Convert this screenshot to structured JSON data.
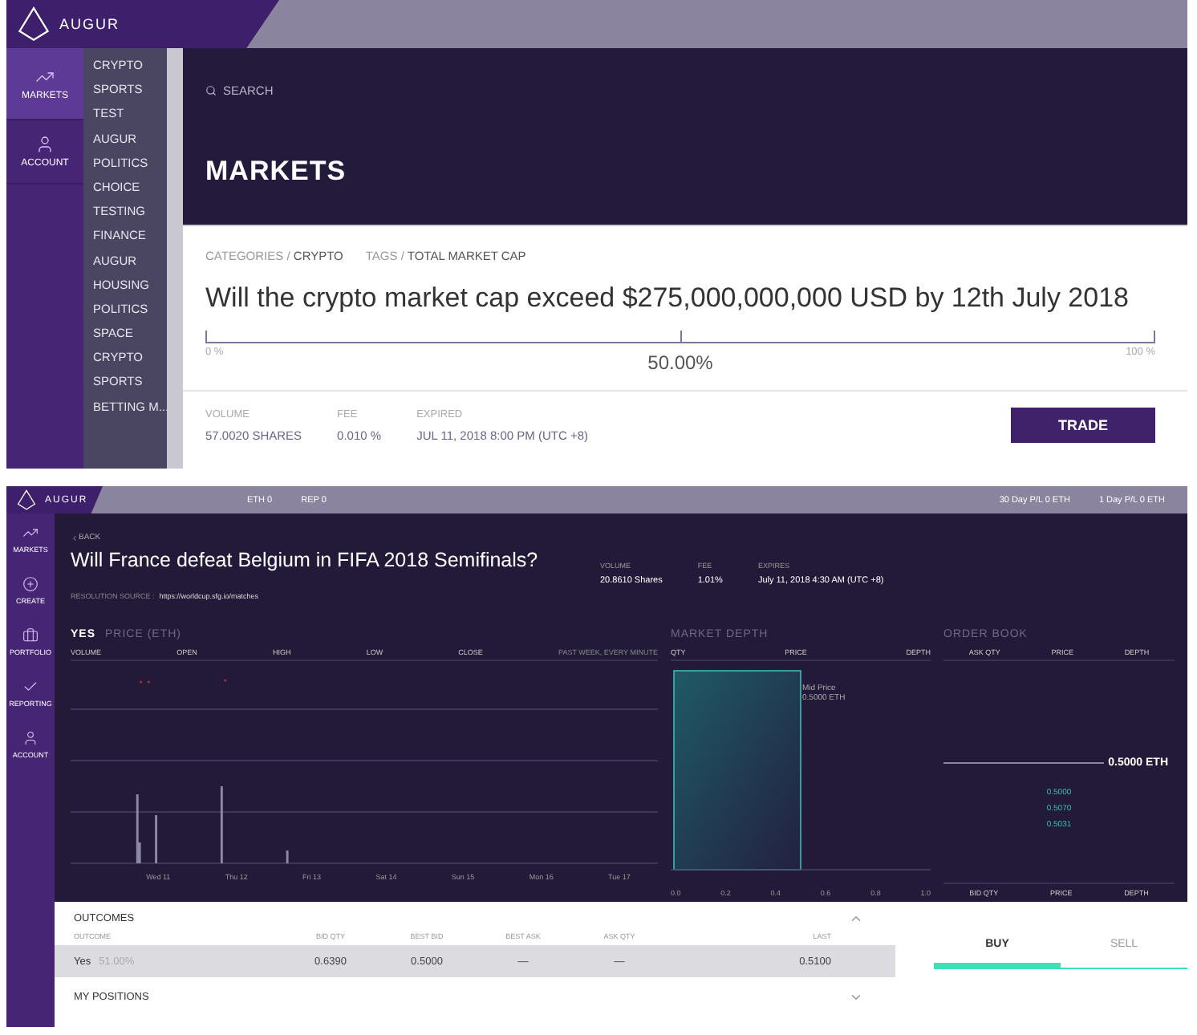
{
  "listing": {
    "brand": "AUGUR",
    "nav": [
      {
        "label": "MARKETS",
        "selected": true
      },
      {
        "label": "ACCOUNT",
        "selected": false
      }
    ],
    "categories": [
      "CRYPTO",
      "SPORTS",
      "TEST",
      "AUGUR",
      "POLITICS",
      "CHOICE",
      "TESTING",
      "FINANCE",
      "AUGUR",
      "HOUSING",
      "POLITICS",
      "SPACE",
      "CRYPTO",
      "SPORTS",
      "BETTING M..."
    ],
    "search": {
      "placeholder": "SEARCH"
    },
    "heading": "MARKETS",
    "market": {
      "category_label": "CATEGORIES",
      "separator": "/",
      "category": "CRYPTO",
      "tags_label": "TAGS",
      "tag": "TOTAL MARKET CAP",
      "title": "Will the crypto market cap exceed $275,000,000,000 USD by 12th July 2018",
      "scale_min": "0 %",
      "scale_max": "100 %",
      "level": 0.5,
      "percent": "50.00%",
      "stats": [
        {
          "label": "VOLUME",
          "value": "57.0020 SHARES"
        },
        {
          "label": "FEE",
          "value": "0.010 %"
        },
        {
          "label": "EXPIRED",
          "value": "JUL 11, 2018 8:00 PM (UTC +8)"
        }
      ],
      "action": "TRADE"
    }
  },
  "trading": {
    "brand": "AUGUR",
    "balances": [
      "ETH 0",
      "REP 0"
    ],
    "pl": [
      "30 Day P/L  0 ETH",
      "1 Day P/L  0 ETH"
    ],
    "nav": [
      {
        "label": "MARKETS",
        "selected": false
      },
      {
        "label": "CREATE",
        "selected": false
      },
      {
        "label": "PORTFOLIO",
        "selected": false
      },
      {
        "label": "REPORTING",
        "selected": false
      },
      {
        "label": "ACCOUNT",
        "selected": false
      }
    ],
    "back": "BACK",
    "title": "Will France defeat Belgium in FIFA 2018 Semifinals?",
    "resolution_label": "RESOLUTION SOURCE :",
    "resolution_url": "https://worldcup.sfg.io/matches",
    "stats": [
      {
        "label": "VOLUME",
        "value": "20.8610 Shares"
      },
      {
        "label": "FEE",
        "value": "1.01%"
      },
      {
        "label": "EXPIRES",
        "value": "July 11, 2018 4:30 AM (UTC +8)"
      }
    ],
    "price_panel": {
      "outcome": "YES",
      "title": "PRICE (ETH)",
      "columns": [
        "VOLUME",
        "OPEN",
        "HIGH",
        "LOW",
        "CLOSE"
      ],
      "range": "PAST WEEK, EVERY MINUTE",
      "days": [
        "Wed 11",
        "Thu 12",
        "Fri 13",
        "Sat 14",
        "Sun 15",
        "Mon 16",
        "Tue 17"
      ]
    },
    "depth_panel": {
      "title": "MARKET DEPTH",
      "columns": [
        "QTY",
        "PRICE",
        "DEPTH"
      ],
      "mid_label": "Mid Price",
      "mid_value": "0.5000 ETH",
      "xticks": [
        "0.0",
        "0.2",
        "0.4",
        "0.6",
        "0.8",
        "1.0"
      ]
    },
    "order_book": {
      "title": "ORDER BOOK",
      "columns": [
        "ASK QTY",
        "PRICE",
        "DEPTH"
      ],
      "mid": "0.5000 ETH",
      "bid_prices": [
        "0.5000",
        "0.5070",
        "0.5031"
      ],
      "footer": [
        "BID QTY",
        "PRICE",
        "DEPTH"
      ]
    },
    "outcomes": {
      "title": "OUTCOMES",
      "expanded": true,
      "outcome_header": "OUTCOME",
      "columns": [
        "BID QTY",
        "BEST BID",
        "BEST ASK",
        "ASK QTY",
        "LAST"
      ],
      "rows": [
        {
          "name": "Yes",
          "percent": "51.00%",
          "cells": [
            "0.6390",
            "0.5000",
            "—",
            "—",
            "0.5100"
          ],
          "selected": true
        }
      ]
    },
    "positions": {
      "title": "MY POSITIONS",
      "expanded": false
    },
    "trade_tabs": [
      {
        "label": "BUY",
        "selected": true
      },
      {
        "label": "SELL",
        "selected": false
      }
    ]
  }
}
